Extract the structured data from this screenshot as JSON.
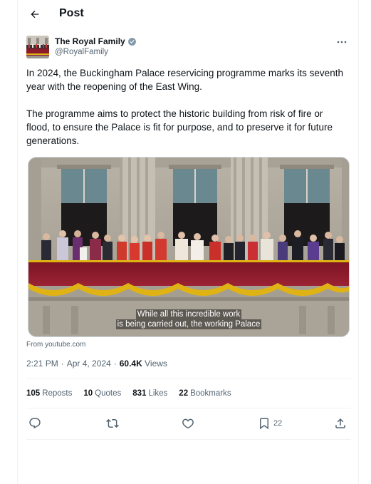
{
  "header": {
    "title": "Post",
    "back_icon": "arrow-left-icon"
  },
  "post": {
    "author": {
      "display_name": "The Royal Family",
      "handle": "@RoyalFamily",
      "verified_badge_color": "#829aab"
    },
    "paragraphs": [
      "In 2024, the Buckingham Palace reservicing programme marks its seventh year with the reopening of the East Wing.",
      "The programme aims to protect the historic building from risk of fire or flood, to ensure the Palace is fit for purpose, and to preserve it for future generations."
    ],
    "media": {
      "caption_line1": "While all this incredible work",
      "caption_line2": "is being carried out, the working Palace"
    },
    "source": "From youtube.com",
    "time": "2:21 PM",
    "separator": "·",
    "date": "Apr 4, 2024",
    "views_count": "60.4K",
    "views_label": "Views"
  },
  "stats": {
    "reposts_count": "105",
    "reposts_label": "Reposts",
    "quotes_count": "10",
    "quotes_label": "Quotes",
    "likes_count": "831",
    "likes_label": "Likes",
    "bookmarks_count": "22",
    "bookmarks_label": "Bookmarks"
  },
  "actions": {
    "bookmark_count": "22",
    "icons": [
      "reply-icon",
      "repost-icon",
      "like-icon",
      "bookmark-icon",
      "share-icon"
    ]
  },
  "colors": {
    "text": "#0f1419",
    "secondary": "#536471",
    "border": "#eff3f4",
    "drape": "#8b1a2b",
    "gold": "#e0b314"
  }
}
